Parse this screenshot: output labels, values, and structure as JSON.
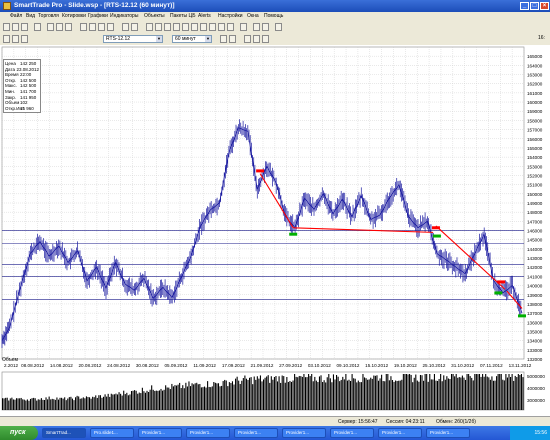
{
  "window": {
    "title": "SmartTrade Pro - Slide.wsp - [RTS-12.12 (60 минут)]",
    "min": "_",
    "max": "□",
    "close": "×"
  },
  "menu": [
    "Файл",
    "Вид",
    "Торговля",
    "Котировки",
    "Графики",
    "Индикаторы",
    "Объекты",
    "Пакеты ЦБ",
    "Alerts",
    "Настройки",
    "Окна",
    "Помощь"
  ],
  "toolbar": {
    "instrument": "RTS-12.12",
    "timeframe": "60 минут",
    "right_label": "16:"
  },
  "info_panel": {
    "rows": [
      {
        "k": "Цена",
        "v": "142 250"
      },
      {
        "k": "Дата",
        "v": "23.08.2012"
      },
      {
        "k": "Время",
        "v": "22:00"
      },
      {
        "k": "Откр.",
        "v": "142 500"
      },
      {
        "k": "Макс.",
        "v": "142 500"
      },
      {
        "k": "Мин.",
        "v": "141 700"
      },
      {
        "k": "Закр.",
        "v": "141 950"
      },
      {
        "k": "Объем",
        "v": "102"
      },
      {
        "k": "Откр.Инт.",
        "v": "15 960"
      }
    ]
  },
  "volume_label": "Объем",
  "status": {
    "server": "Сервер: 15:56:47",
    "session": "Сессия: 04:23:11",
    "exchange": "Обмен: 2б0(1/2б)"
  },
  "taskbar": {
    "start": "пуск",
    "tasks": [
      "SmartTrad...",
      "Pro.slide1...",
      "Provider1...",
      "Provider1...",
      "Provider1...",
      "Provider1...",
      "Provider1...",
      "Provider1...",
      "Provider1..."
    ],
    "clock": "15:56"
  },
  "chart_data": {
    "type": "candlestick",
    "y_ticks": [
      "165000",
      "164000",
      "163000",
      "162000",
      "161000",
      "160000",
      "159000",
      "158000",
      "157000",
      "156000",
      "155000",
      "154000",
      "153000",
      "152000",
      "151000",
      "150000",
      "149000",
      "148000",
      "147000",
      "146000",
      "145000",
      "144000",
      "143000",
      "142000",
      "141000",
      "140000",
      "139000",
      "138000",
      "137000",
      "136000",
      "135000",
      "134000",
      "133000",
      "132000"
    ],
    "ylim": [
      132000,
      166000
    ],
    "x_ticks": [
      "2.2012",
      "08.08.2012",
      "14.08.2012",
      "20.08.2012",
      "24.08.2012",
      "30.08.2012",
      "05.09.2012",
      "11.09.2012",
      "17.09.2012",
      "21.09.2012",
      "27.09.2012",
      "03.10.2012",
      "09.10.2012",
      "15.10.2012",
      "19.10.2012",
      "25.10.2012",
      "31.10.2012",
      "07.11.2012",
      "13.11.2012"
    ],
    "price_path": [
      [
        0,
        134000
      ],
      [
        0.8,
        135500
      ],
      [
        2,
        140000
      ],
      [
        3,
        143500
      ],
      [
        4,
        144800
      ],
      [
        5,
        143200
      ],
      [
        6,
        144300
      ],
      [
        7,
        142500
      ],
      [
        8,
        143800
      ],
      [
        9,
        140500
      ],
      [
        10,
        142000
      ],
      [
        11,
        139700
      ],
      [
        12,
        142500
      ],
      [
        13,
        140200
      ],
      [
        14,
        139500
      ],
      [
        15,
        140800
      ],
      [
        16,
        138600
      ],
      [
        17,
        139800
      ],
      [
        18,
        138700
      ],
      [
        19,
        141000
      ],
      [
        20,
        143200
      ],
      [
        21,
        146500
      ],
      [
        22,
        148200
      ],
      [
        23,
        149000
      ],
      [
        24,
        154500
      ],
      [
        25,
        157200
      ],
      [
        26,
        156800
      ],
      [
        27,
        150500
      ],
      [
        28,
        153000
      ],
      [
        29,
        151200
      ],
      [
        30,
        147500
      ],
      [
        31,
        146300
      ],
      [
        32,
        149500
      ],
      [
        33,
        148300
      ],
      [
        34,
        150000
      ],
      [
        35,
        147800
      ],
      [
        36,
        149400
      ],
      [
        37,
        147500
      ],
      [
        38,
        149800
      ],
      [
        39,
        147200
      ],
      [
        40,
        147700
      ],
      [
        41,
        149600
      ],
      [
        42,
        151000
      ],
      [
        43,
        147500
      ],
      [
        44,
        146300
      ],
      [
        45,
        147000
      ],
      [
        46,
        143500
      ],
      [
        47,
        142800
      ],
      [
        48,
        142000
      ],
      [
        49,
        141300
      ],
      [
        50,
        143500
      ],
      [
        51,
        145600
      ],
      [
        52,
        140500
      ],
      [
        53,
        139200
      ],
      [
        54,
        140000
      ],
      [
        55,
        137000
      ]
    ],
    "horizontal_lines": [
      146000,
      144600,
      142300,
      141000,
      138500
    ],
    "trend_lines": [
      [
        152200,
        146300
      ],
      [
        146300,
        145800
      ],
      [
        146500,
        139600
      ],
      [
        139400,
        137500
      ]
    ],
    "volume_values": [
      0.3,
      0.32,
      0.3,
      0.3,
      0.32,
      0.33,
      0.31,
      0.32,
      0.35,
      0.34,
      0.38,
      0.4,
      0.45,
      0.48,
      0.52,
      0.56,
      0.6,
      0.62,
      0.64,
      0.66,
      0.7,
      0.72,
      0.72,
      0.74,
      0.78,
      0.82,
      0.84,
      0.86,
      0.86,
      0.88,
      0.88,
      0.88,
      0.9,
      0.88,
      0.88,
      0.9,
      0.9,
      0.9,
      0.9,
      0.92,
      0.92,
      0.92,
      0.9,
      0.92,
      0.9,
      0.92,
      0.94,
      0.94,
      0.95,
      0.96,
      0.96,
      0.96,
      0.95,
      0.96,
      0.95,
      0.97
    ],
    "volume_ticks": [
      "5000000",
      "4000000",
      "3000000"
    ],
    "colors": {
      "candle": "#1a1aa0",
      "trend": "#ff0000",
      "hline": "#1a1a8a",
      "grid": "#c8c8c8",
      "volume": "#000000"
    }
  }
}
